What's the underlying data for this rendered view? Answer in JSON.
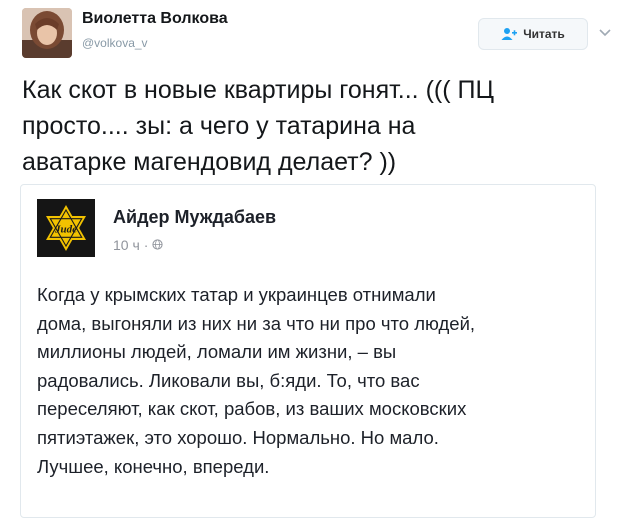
{
  "tweet": {
    "author": {
      "name": "Виолетта Волкова",
      "handle": "@volkova_v"
    },
    "follow_label": "Читать",
    "text_lines": [
      "Как скот в новые квартиры гонят... ((( ПЦ",
      "просто....  зы: а чего у татарина на",
      "аватарке магендовид делает? ))"
    ],
    "icons": {
      "follow": "add-user-icon",
      "menu": "chevron-down-icon"
    }
  },
  "quote": {
    "author": "Айдер Муждабаев",
    "time": "10 ч",
    "separator": "·",
    "privacy_icon": "globe-icon",
    "avatar_text": "Jude",
    "text_lines": [
      "Когда у крымских татар и украинцев отнимали",
      "дома, выгоняли из них ни за что ни про что людей,",
      "миллионы людей, ломали им жизни, – вы",
      "радовались. Ликовали вы, б:яди. То, что вас",
      "переселяют, как скот, рабов, из ваших московских",
      "пятиэтажек, это хорошо. Нормально. Но мало.",
      "Лучшее, конечно, впереди."
    ]
  },
  "colors": {
    "primary_text": "#14171a",
    "secondary_text": "#8899a6",
    "accent": "#1da1f2",
    "card_border": "#e1e8ed",
    "star": "#f2c200"
  }
}
